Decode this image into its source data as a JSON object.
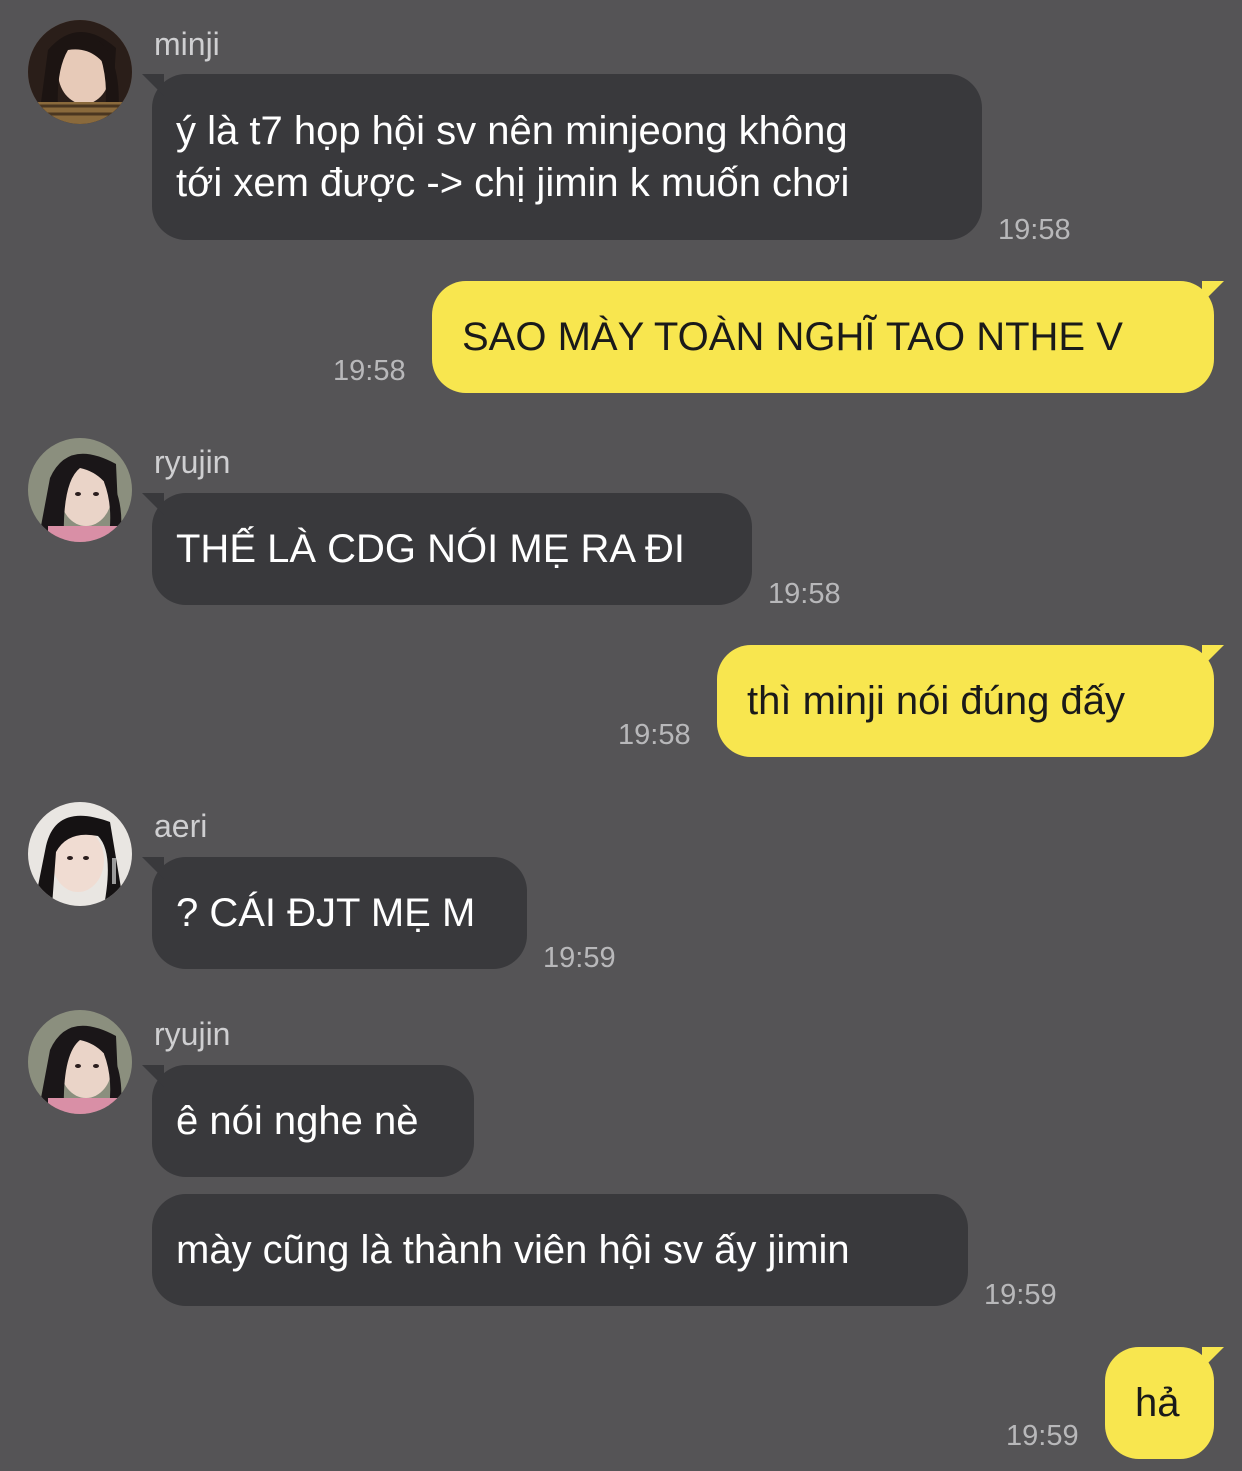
{
  "messages": [
    {
      "sender": "minji",
      "lines": [
        "ý là t7 họp hội sv nên minjeong không",
        "tới xem được -> chị jimin k muốn chơi"
      ],
      "time": "19:58"
    },
    {
      "sender": "me",
      "lines": [
        "SAO MÀY TOÀN NGHĨ TAO NTHE V"
      ],
      "time": "19:58"
    },
    {
      "sender": "ryujin",
      "lines": [
        "THẾ LÀ CDG NÓI MẸ RA ĐI"
      ],
      "time": "19:58"
    },
    {
      "sender": "me",
      "lines": [
        "thì minji nói đúng đấy"
      ],
      "time": "19:58"
    },
    {
      "sender": "aeri",
      "lines": [
        "? CÁI ĐJT MẸ M"
      ],
      "time": "19:59"
    },
    {
      "sender": "ryujin",
      "lines": [
        "ê nói nghe nè"
      ],
      "time": ""
    },
    {
      "sender": "ryujin",
      "lines": [
        "mày cũng là thành viên hội sv ấy jimin"
      ],
      "time": "19:59"
    },
    {
      "sender": "me",
      "lines": [
        "hả"
      ],
      "time": "19:59"
    }
  ],
  "colors": {
    "background": "#555456",
    "incoming_bubble": "#39393c",
    "outgoing_bubble": "#f8e64f"
  },
  "icons": {
    "avatar": "profile-photo"
  }
}
